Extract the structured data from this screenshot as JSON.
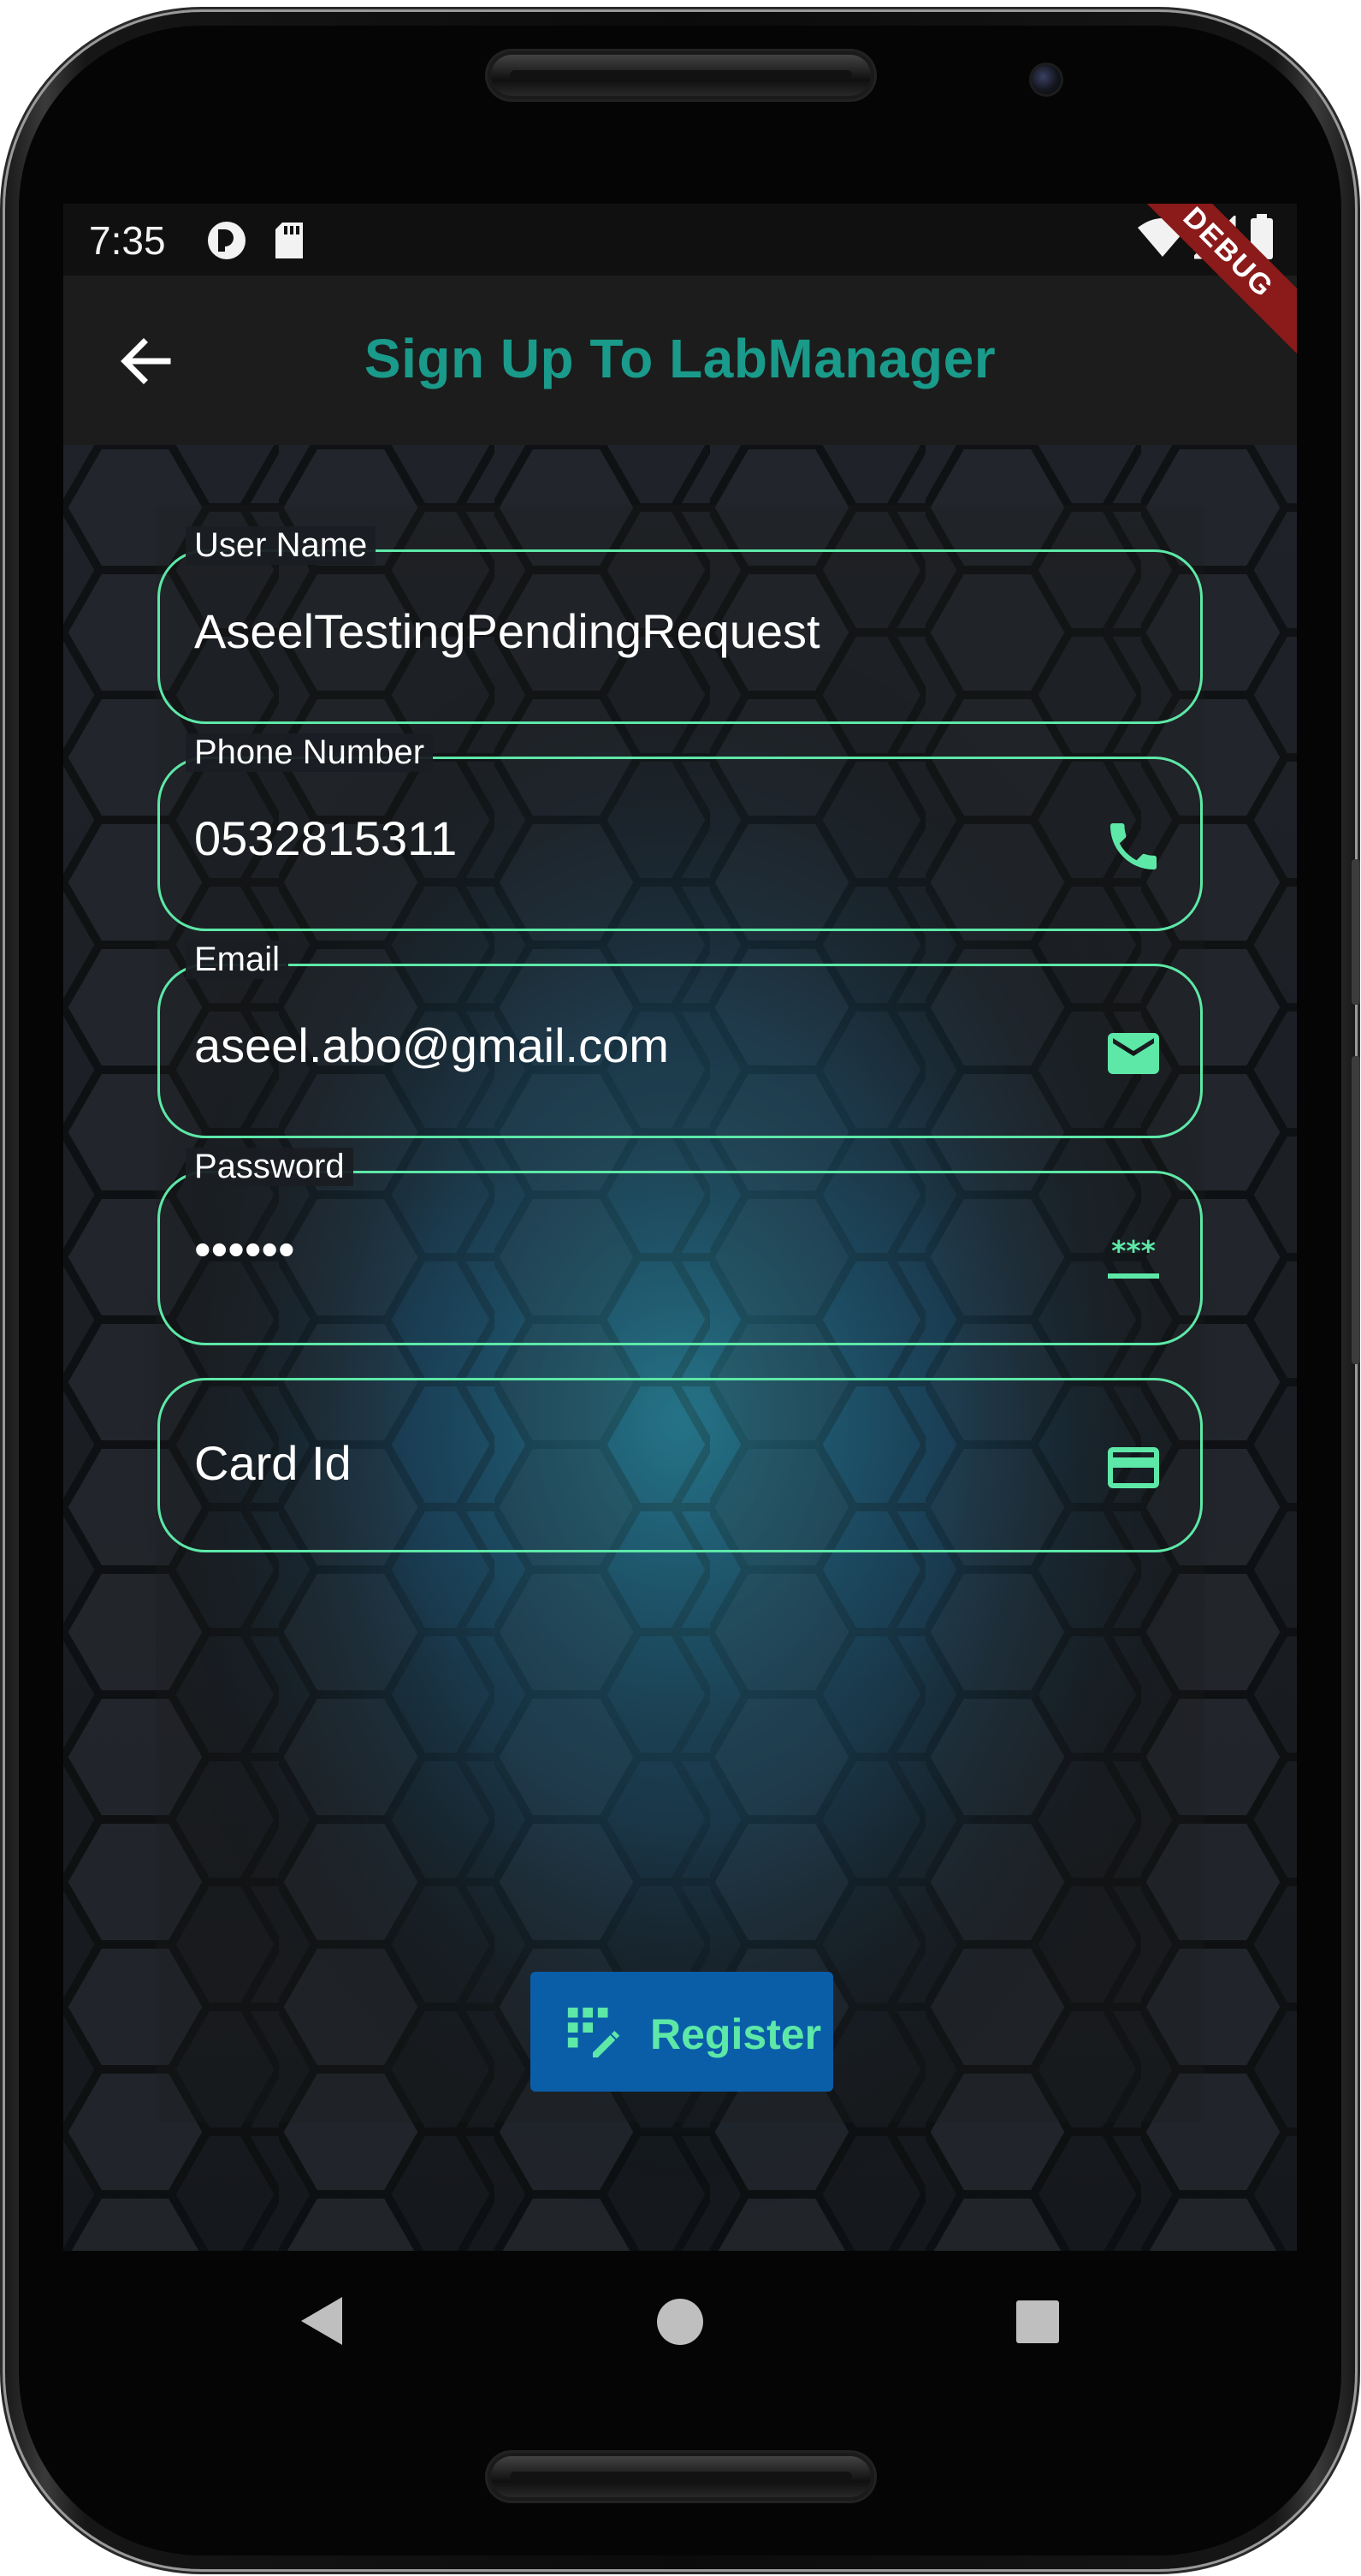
{
  "status_bar": {
    "time": "7:35"
  },
  "app_bar": {
    "title": "Sign Up To LabManager",
    "debug_banner": "DEBUG"
  },
  "form": {
    "fields": [
      {
        "label": "User Name",
        "value": "AseelTestingPendingRequest",
        "icon": ""
      },
      {
        "label": "Phone Number",
        "value": "0532815311",
        "icon": "phone-icon"
      },
      {
        "label": "Email",
        "value": "aseel.abo@gmail.com",
        "icon": "email-icon"
      },
      {
        "label": "Password",
        "value": "••••••",
        "icon": "password-icon"
      },
      {
        "label": "",
        "placeholder": "Card Id",
        "icon": "credit-card-icon"
      }
    ],
    "register_label": "Register"
  },
  "colors": {
    "accent": "#5de8a8",
    "title": "#1a9a8a",
    "button": "#0a5ea8",
    "appbar": "#1c1c1c"
  }
}
